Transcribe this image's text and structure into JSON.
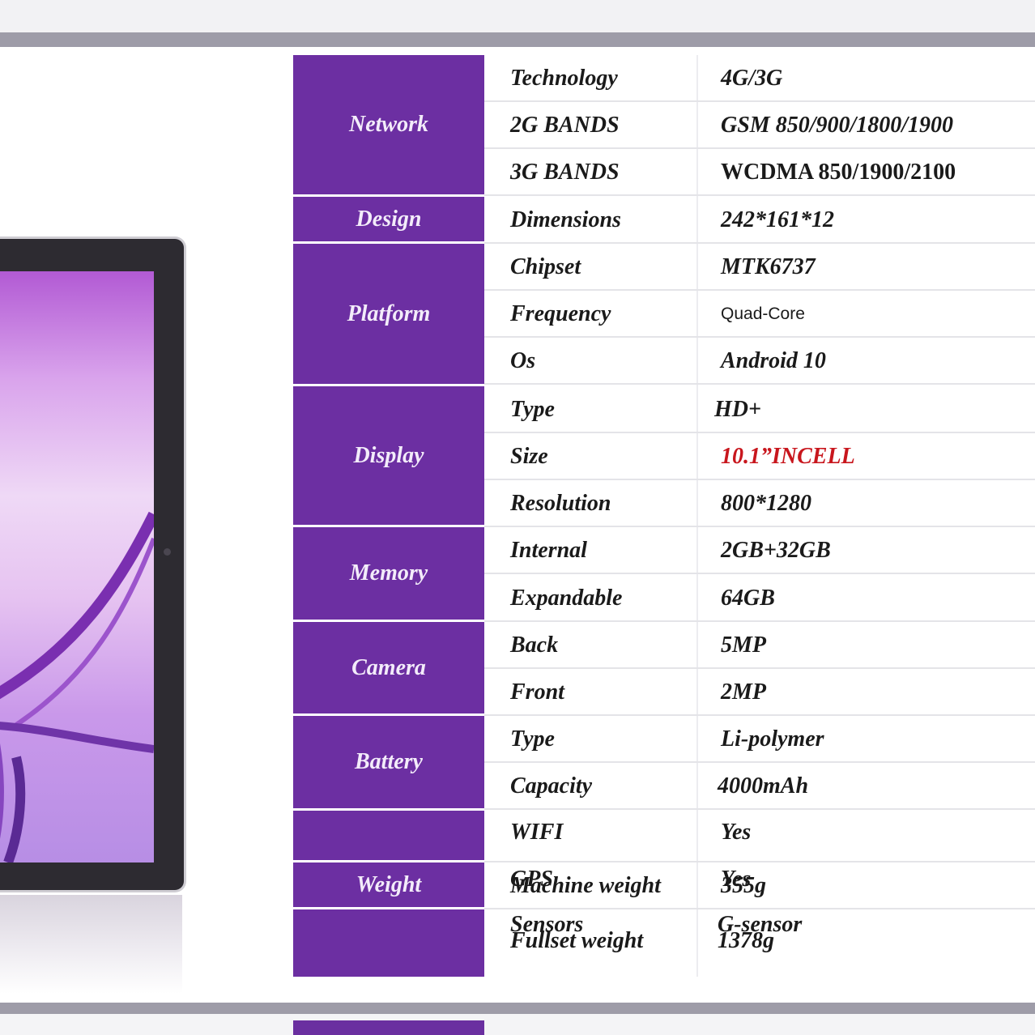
{
  "groups": {
    "network": "Network",
    "design": "Design",
    "platform": "Platform",
    "display": "Display",
    "memory": "Memory",
    "camera": "Camera",
    "battery": "Battery",
    "weight": "Weight"
  },
  "rows": [
    {
      "label": "Technology",
      "value": "4G/3G"
    },
    {
      "label": "2G BANDS",
      "value": "GSM 850/900/1800/1900"
    },
    {
      "label": "3G BANDS",
      "value": "WCDMA 850/1900/2100"
    },
    {
      "label": "Dimensions",
      "value": "242*161*12"
    },
    {
      "label": "Chipset",
      "value": "MTK6737"
    },
    {
      "label": "Frequency",
      "value": "Quad-Core"
    },
    {
      "label": "Os",
      "value": "Android 10"
    },
    {
      "label": "Type",
      "value": "HD+"
    },
    {
      "label": "Size",
      "value": "10.1”INCELL"
    },
    {
      "label": "Resolution",
      "value": "800*1280"
    },
    {
      "label": "Internal",
      "value": "2GB+32GB"
    },
    {
      "label": "Expandable",
      "value": "64GB"
    },
    {
      "label": "Back",
      "value": "5MP"
    },
    {
      "label": "Front",
      "value": "2MP"
    },
    {
      "label": "Type",
      "value": "Li-polymer"
    },
    {
      "label": "Capacity",
      "value": "4000mAh"
    },
    {
      "label": "WIFI",
      "value": "Yes"
    }
  ],
  "overlap_rows": [
    {
      "label_a": "GPS",
      "label_b": "Machine weight",
      "value_a": "Yes",
      "value_b": "355g"
    },
    {
      "label_a": "Sensors",
      "label_b": "Fullset weight",
      "value_a": "G-sensor",
      "value_b": "1378g"
    }
  ],
  "colors": {
    "group_bg": "#6c2fa2",
    "highlight": "#c8161d"
  }
}
